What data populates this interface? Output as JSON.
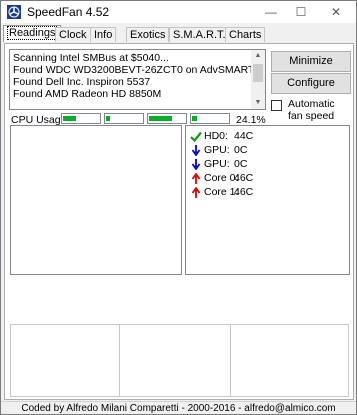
{
  "window": {
    "title": "SpeedFan 4.52"
  },
  "tabs": [
    {
      "label": "Readings",
      "active": true
    },
    {
      "label": "Clock"
    },
    {
      "label": "Info"
    },
    {
      "label": "Exotics"
    },
    {
      "label": "S.M.A.R.T."
    },
    {
      "label": "Charts"
    }
  ],
  "log": {
    "lines": [
      "Scanning Intel SMBus at $5040...",
      "Found WDC WD3200BEVT-26ZCT0 on AdvSMART",
      "Found Dell Inc. Inspiron 5537",
      "Found AMD Radeon HD 8850M"
    ]
  },
  "buttons": {
    "minimize": "Minimize",
    "configure": "Configure"
  },
  "autofan": {
    "label": "Automatic fan speed",
    "checked": false
  },
  "cpu": {
    "label": "CPU Usage",
    "meters": [
      0.35,
      0.12,
      0.65,
      0.15
    ],
    "percent": "24.1%"
  },
  "sensors": [
    {
      "name": "HD0:",
      "value": "44C",
      "icon": "check-icon",
      "color": "#119911"
    },
    {
      "name": "GPU:",
      "value": "0C",
      "icon": "arrow-down-icon",
      "color": "#0000dd"
    },
    {
      "name": "GPU:",
      "value": "0C",
      "icon": "arrow-down-icon",
      "color": "#0000dd"
    },
    {
      "name": "Core 0:",
      "value": "46C",
      "icon": "arrow-up-icon",
      "color": "#dd0000"
    },
    {
      "name": "Core 1:",
      "value": "46C",
      "icon": "arrow-up-icon",
      "color": "#dd0000"
    }
  ],
  "status": "Coded by Alfredo Milani Comparetti - 2000-2016 - alfredo@almico.com"
}
